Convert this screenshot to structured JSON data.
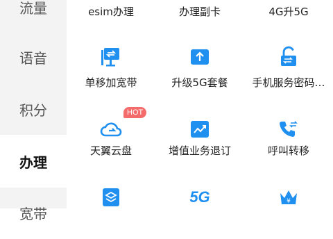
{
  "sidebar": {
    "items": [
      {
        "label": "流量"
      },
      {
        "label": "语音"
      },
      {
        "label": "积分"
      },
      {
        "label": "办理"
      },
      {
        "label": "宽带"
      }
    ]
  },
  "grid": {
    "row0": [
      "esim办理",
      "办理副卡",
      "4G升5G"
    ],
    "row1": [
      "单移加宽带",
      "升级5G套餐",
      "手机服务密码…"
    ],
    "row2": [
      "天翼云盘",
      "增值业务退订",
      "呼叫转移"
    ],
    "hot_badge": "HOT",
    "icon5g_text": "5G"
  },
  "colors": {
    "accent": "#1f8ff0",
    "hot": "#f46b6b",
    "sidebar_bg": "#f3f3f3"
  }
}
